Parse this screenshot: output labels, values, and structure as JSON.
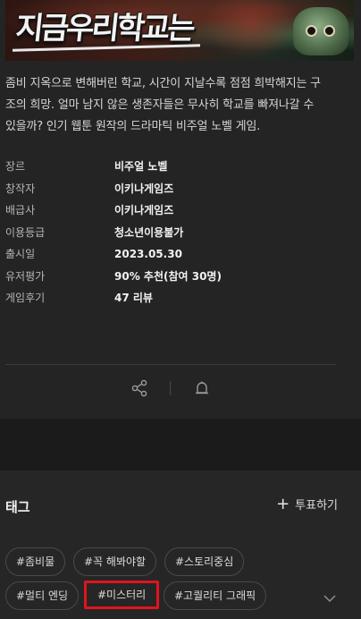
{
  "banner": {
    "logo_text": "지금우리학교는"
  },
  "description": {
    "line1": "좀비 지옥으로 변해버린 학교, 시간이 지날수록 점점 희박해지는 구",
    "line2": "조의 희망. 얼마 남지 않은 생존자들은 무사히 학교를 빠져나갈 수",
    "line3": "있을까? 인기 웹툰 원작의 드라마틱 비주얼 노벨 게임."
  },
  "info": [
    {
      "label": "장르",
      "value": "비주얼 노벨"
    },
    {
      "label": "창작자",
      "value": "이키나게임즈"
    },
    {
      "label": "배급사",
      "value": "이키나게임즈"
    },
    {
      "label": "이용등급",
      "value": "청소년이용불가"
    },
    {
      "label": "출시일",
      "value": "2023.05.30"
    },
    {
      "label": "유저평가",
      "value": "90% 추천(참여 30명)"
    },
    {
      "label": "게임후기",
      "value": "47 리뷰"
    }
  ],
  "actions": {
    "share_icon": "share-icon",
    "alarm_icon": "bell-icon"
  },
  "tags": {
    "title": "태그",
    "vote_label": "투표하기",
    "items": [
      "#좀비물",
      "#꼭 해봐야할",
      "#스토리중심",
      "#멀티 엔딩",
      "#미스터리",
      "#고퀄리티 그래픽"
    ],
    "highlighted_index": 4,
    "highlight_color": "#e0141e"
  }
}
